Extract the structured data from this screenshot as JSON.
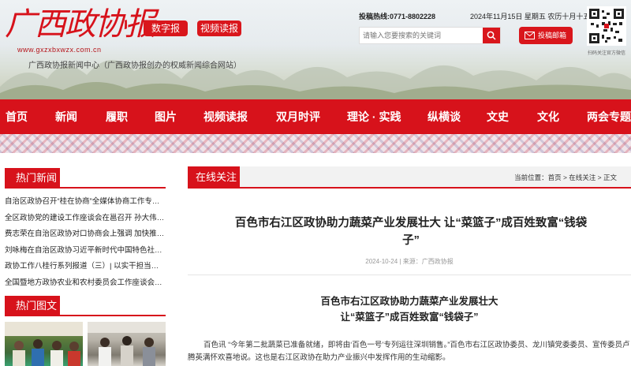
{
  "header": {
    "logo_text": "广西政协报",
    "logo_url": "www.gxzxbxwzx.com.cn",
    "slogan": "广西政协报新闻中心（广西政协报创办的权威新闻综合网站）",
    "btn_digital": "数字报",
    "btn_video": "视频读报",
    "hotline_label": "投稿热线:",
    "hotline_number": "0771-8802228",
    "date": "2024年11月15日 星期五 农历十月十五",
    "search_placeholder": "请输入您要搜索的关键词",
    "mail_label": "投稿邮箱",
    "qr_caption": "扫码关注官方微信"
  },
  "nav": {
    "items": [
      "首页",
      "新闻",
      "履职",
      "图片",
      "视频读报",
      "双月时评",
      "理论 · 实践",
      "纵横谈",
      "文史",
      "文化",
      "两会专题"
    ]
  },
  "sidebar": {
    "hot_news_title": "热门新闻",
    "hot_news": [
      "自治区政协召开“桂在协商”全媒体协商工作专题...",
      "全区政协党的建设工作座谈会在邕召开 孙大伟出...",
      "费志荣在自治区政协对口协商会上强调 加快推进...",
      "刘咏梅在自治区政协习近平新时代中国特色社会...",
      "政协工作八桂行系列报道（三）| 以实干担当书写...",
      "全国暨地方政协农业和农村委员会工作座谈会在..."
    ],
    "hot_photos_title": "热门图文"
  },
  "main": {
    "section_tab": "在线关注",
    "breadcrumb": "当前位置：首页 > 在线关注 > 正文",
    "title": "百色市右江区政协助力蔬菜产业发展壮大 让“菜篮子”成百姓致富“钱袋子”",
    "meta": "2024-10-24 | 来源：广西政协报",
    "subtitle_line1": "百色市右江区政协助力蔬菜产业发展壮大",
    "subtitle_line2": "让“菜篮子”成百姓致富“钱袋子”",
    "paragraph": "百色讯 “今年第二批蔬菜已准备就绪，即将由‘百色一号’专列运往深圳销售。”百色市右江区政协委员、龙川镇党委委员、宣传委员卢腾英满怀欢喜地说。这也是右江区政协在助力产业振兴中发挥作用的生动缩影。"
  },
  "colors": {
    "brand_red": "#d7121b"
  }
}
